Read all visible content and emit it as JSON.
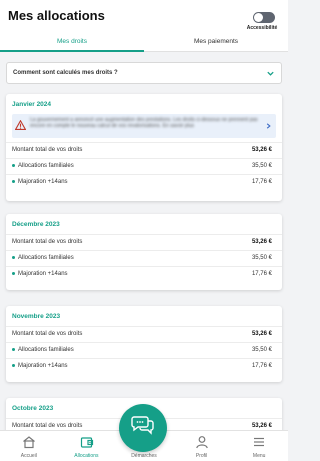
{
  "header": {
    "title": "Mes allocations",
    "accessibility_label": "Accessibilité",
    "accessibility_on": false
  },
  "tabs": [
    {
      "label": "Mes droits",
      "active": true
    },
    {
      "label": "Mes paiements",
      "active": false
    }
  ],
  "faq": {
    "label": "Comment sont calculés mes droits ?"
  },
  "cards": [
    {
      "month": "Janvier 2024",
      "alert": {
        "text": "La gouvernement a annoncé une augmentation des prestations. Les droits ci-dessous ne prennent pas encore en compte le nouveau calcul de vos revalorisations. En savoir plus"
      },
      "total_label": "Montant total de vos droits",
      "total_value": "53,26 €",
      "items": [
        {
          "label": "Allocations familiales",
          "value": "35,50 €"
        },
        {
          "label": "Majoration +14ans",
          "value": "17,76 €"
        }
      ]
    },
    {
      "month": "Décembre 2023",
      "total_label": "Montant total de vos droits",
      "total_value": "53,26 €",
      "items": [
        {
          "label": "Allocations familiales",
          "value": "35,50 €"
        },
        {
          "label": "Majoration +14ans",
          "value": "17,76 €"
        }
      ]
    },
    {
      "month": "Novembre 2023",
      "total_label": "Montant total de vos droits",
      "total_value": "53,26 €",
      "items": [
        {
          "label": "Allocations familiales",
          "value": "35,50 €"
        },
        {
          "label": "Majoration +14ans",
          "value": "17,76 €"
        }
      ]
    },
    {
      "month": "Octobre 2023",
      "total_label": "Montant total de vos droits",
      "total_value": "53,26 €"
    }
  ],
  "nav": [
    {
      "label": "Accueil",
      "icon": "home-icon",
      "active": false
    },
    {
      "label": "Allocations",
      "icon": "allocations-icon",
      "active": true
    },
    {
      "label": "Démarches",
      "icon": "document-icon",
      "active": false
    },
    {
      "label": "Profil",
      "icon": "profile-icon",
      "active": false
    },
    {
      "label": "Menu",
      "icon": "menu-icon",
      "active": false
    }
  ],
  "fab": {
    "icon": "chat-icon"
  },
  "colors": {
    "accent": "#159f88",
    "alert_bg": "#e9f0fa",
    "warning": "#c0392b"
  }
}
